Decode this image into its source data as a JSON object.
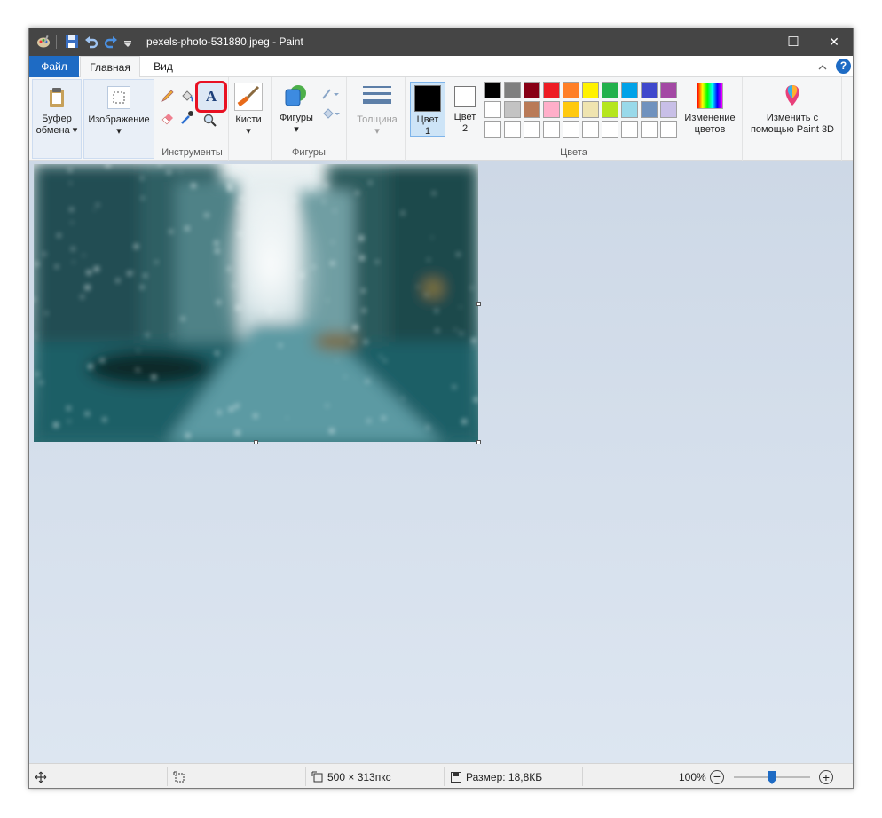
{
  "window": {
    "title": "pexels-photo-531880.jpeg - Paint"
  },
  "window_controls": {
    "minimize": "—",
    "maximize": "☐",
    "close": "✕"
  },
  "menu": {
    "file": "Файл",
    "home": "Главная",
    "view": "Вид"
  },
  "ribbon": {
    "clipboard": {
      "label": "Буфер",
      "label2": "обмена"
    },
    "image": {
      "label": "Изображение"
    },
    "tools": {
      "group_label": "Инструменты"
    },
    "brushes": {
      "label": "Кисти"
    },
    "shapes": {
      "label": "Фигуры",
      "group_label": "Фигуры"
    },
    "size": {
      "label": "Толщина"
    },
    "color1": {
      "label": "Цвет",
      "num": "1"
    },
    "color2": {
      "label": "Цвет",
      "num": "2"
    },
    "edit_colors": {
      "label": "Изменение",
      "label2": "цветов"
    },
    "paint3d": {
      "label": "Изменить с",
      "label2": "помощью Paint 3D"
    },
    "colors_group_label": "Цвета"
  },
  "palette": {
    "row1": [
      "#000000",
      "#7f7f7f",
      "#880015",
      "#ed1c24",
      "#ff7f27",
      "#fff200",
      "#22b14c",
      "#00a2e8",
      "#3f48cc",
      "#a349a4"
    ],
    "row2": [
      "#ffffff",
      "#c3c3c3",
      "#b97a57",
      "#ffaec9",
      "#ffc90e",
      "#efe4b0",
      "#b5e61d",
      "#99d9ea",
      "#7092be",
      "#c8bfe7"
    ],
    "row3": [
      "#ffffff",
      "#ffffff",
      "#ffffff",
      "#ffffff",
      "#ffffff",
      "#ffffff",
      "#ffffff",
      "#ffffff",
      "#ffffff",
      "#ffffff"
    ]
  },
  "status": {
    "dimensions": "500 × 313пкс",
    "size": "Размер: 18,8КБ",
    "zoom": "100%",
    "zoom_level": 0.5
  },
  "colors": {
    "accent": "#1e6bc4",
    "highlight": "#e81123"
  }
}
